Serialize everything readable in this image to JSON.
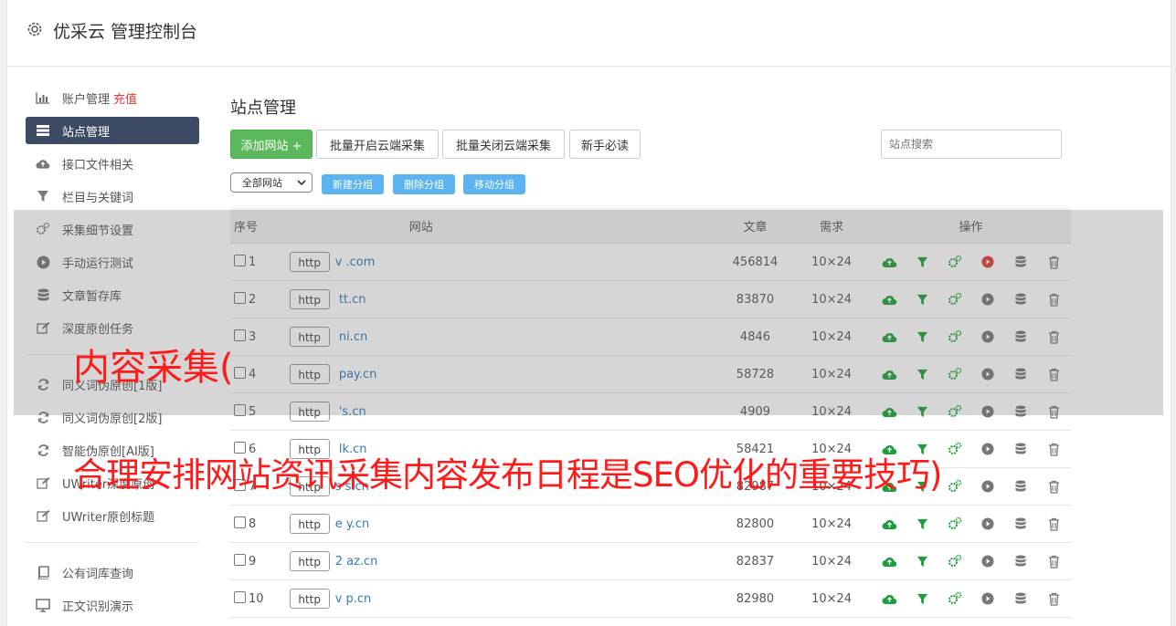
{
  "header": {
    "title": "优采云 管理控制台"
  },
  "sidebar": {
    "items": [
      {
        "label": "账户管理",
        "badge": "充值",
        "icon": "bar-chart-icon"
      },
      {
        "label": "站点管理",
        "icon": "server-list-icon"
      },
      {
        "label": "接口文件相关",
        "icon": "cloud-upload-icon"
      },
      {
        "label": "栏目与关键词",
        "icon": "filter-icon"
      },
      {
        "label": "采集细节设置",
        "icon": "cogs-icon"
      },
      {
        "label": "手动运行测试",
        "icon": "play-circle-icon"
      },
      {
        "label": "文章暂存库",
        "icon": "database-icon"
      },
      {
        "label": "深度原创任务",
        "icon": "edit-icon"
      },
      {
        "label": "同义词伪原创[1版]",
        "icon": "refresh-icon"
      },
      {
        "label": "同义词伪原创[2版]",
        "icon": "refresh-icon"
      },
      {
        "label": "智能伪原创[AI版]",
        "icon": "refresh-icon"
      },
      {
        "label": "UWriter深度原创",
        "icon": "edit-icon"
      },
      {
        "label": "UWriter原创标题",
        "icon": "edit-icon"
      },
      {
        "label": "公有词库查询",
        "icon": "book-icon"
      },
      {
        "label": "正文识别演示",
        "icon": "monitor-icon"
      }
    ]
  },
  "main": {
    "title": "站点管理",
    "buttons": {
      "add_site": "添加网站 +",
      "batch_open": "批量开启云端采集",
      "batch_close": "批量关闭云端采集",
      "newbie": "新手必读"
    },
    "search_placeholder": "站点搜索",
    "group_select": "全部网站",
    "group_buttons": {
      "new": "新建分组",
      "delete": "删除分组",
      "move": "移动分组"
    },
    "table": {
      "headers": {
        "idx": "序号",
        "site": "网站",
        "articles": "文章",
        "demand": "需求",
        "ops": "操作"
      },
      "rows": [
        {
          "idx": "1",
          "http": "http",
          "site": "v           .com",
          "articles": "456814",
          "demand": "10×24",
          "play_red": true
        },
        {
          "idx": "2",
          "http": "http",
          "site": "      tt.cn",
          "articles": "83870",
          "demand": "10×24",
          "play_red": false
        },
        {
          "idx": "3",
          "http": "http",
          "site": "       ni.cn",
          "articles": "4846",
          "demand": "10×24",
          "play_red": false
        },
        {
          "idx": "4",
          "http": "http",
          "site": "        pay.cn",
          "articles": "58728",
          "demand": "10×24",
          "play_red": false
        },
        {
          "idx": "5",
          "http": "http",
          "site": "       's.cn",
          "articles": "4909",
          "demand": "10×24",
          "play_red": false
        },
        {
          "idx": "6",
          "http": "http",
          "site": "      lk.cn",
          "articles": "58421",
          "demand": "10×24",
          "play_red": false
        },
        {
          "idx": "7",
          "http": "http",
          "site": "s       s.cn",
          "articles": "82987",
          "demand": "10×24",
          "play_red": false
        },
        {
          "idx": "8",
          "http": "http",
          "site": "e      y.cn",
          "articles": "82800",
          "demand": "10×24",
          "play_red": false
        },
        {
          "idx": "9",
          "http": "http",
          "site": "2      az.cn",
          "articles": "82837",
          "demand": "10×24",
          "play_red": false
        },
        {
          "idx": "10",
          "http": "http",
          "site": "v      p.cn",
          "articles": "82980",
          "demand": "10×24",
          "play_red": false
        }
      ]
    }
  },
  "overlay": {
    "caption_line1": "内容采集(",
    "caption_line2": "合理安排网站资讯采集内容发布日程是SEO优化的重要技巧)"
  },
  "colors": {
    "sidebar_active": "#3d4a63",
    "add_button": "#5cb85c",
    "group_button": "#5bb4f0",
    "link_blue": "#337ab7",
    "op_green": "#1e9e3a",
    "play_red": "#e53935",
    "caption_red": "#ff1a1a"
  }
}
